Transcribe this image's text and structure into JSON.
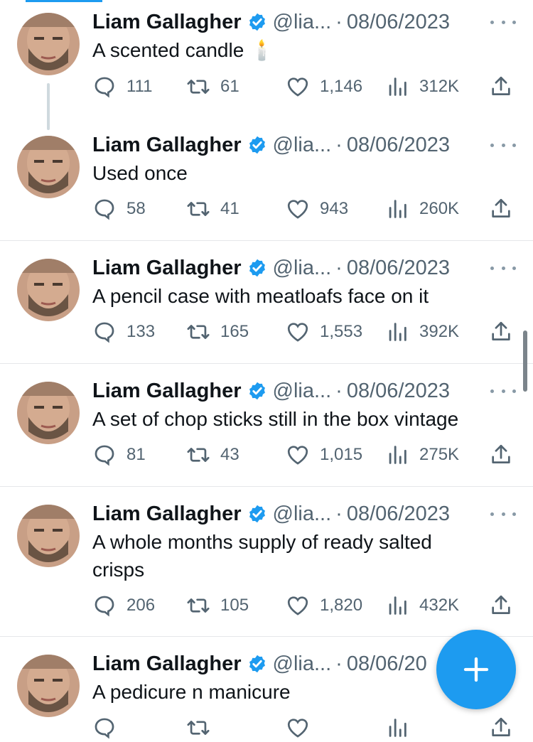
{
  "tweets": [
    {
      "name": "Liam Gallagher",
      "handle": "@lia...",
      "dot": "·",
      "date": "08/06/2023",
      "text": "A scented candle",
      "emoji": "🕯️",
      "replies": "111",
      "retweets": "61",
      "likes": "1,146",
      "views": "312K"
    },
    {
      "name": "Liam Gallagher",
      "handle": "@lia...",
      "dot": "·",
      "date": "08/06/2023",
      "text": "Used once",
      "replies": "58",
      "retweets": "41",
      "likes": "943",
      "views": "260K"
    },
    {
      "name": "Liam Gallagher",
      "handle": "@lia...",
      "dot": "·",
      "date": "08/06/2023",
      "text": "A pencil case with meatloafs face on it",
      "replies": "133",
      "retweets": "165",
      "likes": "1,553",
      "views": "392K"
    },
    {
      "name": "Liam Gallagher",
      "handle": "@lia...",
      "dot": "·",
      "date": "08/06/2023",
      "text": "A set of chop sticks still in the box vintage",
      "replies": "81",
      "retweets": "43",
      "likes": "1,015",
      "views": "275K"
    },
    {
      "name": "Liam Gallagher",
      "handle": "@lia...",
      "dot": "·",
      "date": "08/06/2023",
      "text": "A whole months supply of ready salted crisps",
      "replies": "206",
      "retweets": "105",
      "likes": "1,820",
      "views": "432K"
    },
    {
      "name": "Liam Gallagher",
      "handle": "@lia...",
      "dot": "·",
      "date": "08/06/20",
      "text": "A pedicure n manicure",
      "replies": "",
      "retweets": "",
      "likes": "",
      "views": ""
    }
  ],
  "icons": {
    "reply": "reply-icon",
    "retweet": "retweet-icon",
    "like": "heart-icon",
    "views": "views-icon",
    "share": "share-icon",
    "verified": "verified-icon",
    "more": "more-icon",
    "compose": "compose-plus-icon"
  },
  "colors": {
    "accent": "#1d9bf0",
    "text": "#0f1419",
    "muted": "#536471"
  }
}
